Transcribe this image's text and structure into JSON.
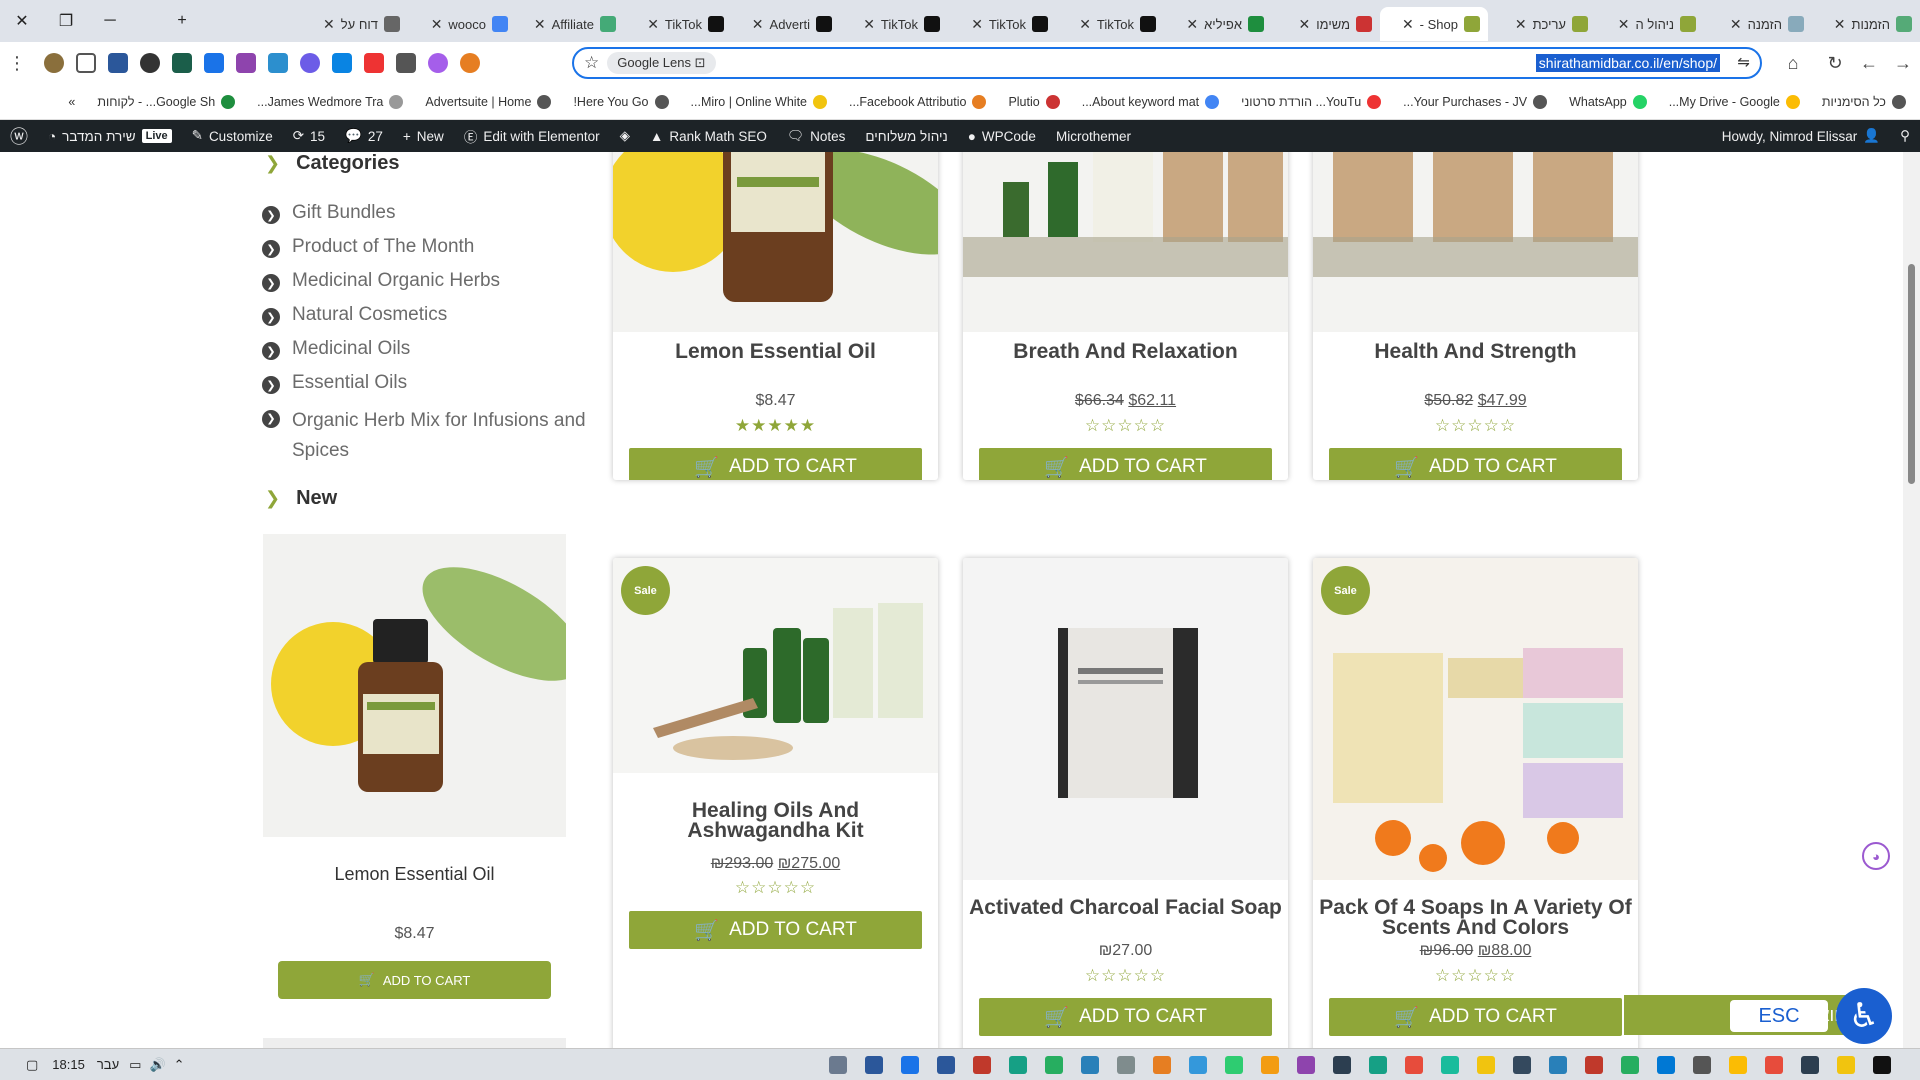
{
  "browser": {
    "tabs": [
      {
        "title": "הזמנות",
        "color": "#5a7"
      },
      {
        "title": "הזמנה",
        "color": "#8ab"
      },
      {
        "title": "ניהול ה",
        "color": "#8fa639"
      },
      {
        "title": "עריכת",
        "color": "#8fa639"
      },
      {
        "title": "Shop -",
        "color": "#8fa639",
        "active": true
      },
      {
        "title": "משימו",
        "color": "#c33"
      },
      {
        "title": "אפיליא",
        "color": "#1e8e3e"
      },
      {
        "title": "TikTok",
        "color": "#111"
      },
      {
        "title": "TikTok",
        "color": "#111"
      },
      {
        "title": "TikTok",
        "color": "#111"
      },
      {
        "title": "Adverti",
        "color": "#111"
      },
      {
        "title": "TikTok",
        "color": "#111"
      },
      {
        "title": "Affiliate",
        "color": "#4a7"
      },
      {
        "title": "wooco",
        "color": "#4285f4"
      },
      {
        "title": "דוח על",
        "color": "#666"
      }
    ],
    "omnibox": {
      "lens_label": "Google Lens",
      "url": "shirathamidbar.co.il/en/shop/"
    },
    "bookmarks": [
      {
        "label": "כל הסימניות",
        "color": "#555"
      },
      {
        "label": "My Drive - Google...",
        "color": "#fbbc04"
      },
      {
        "label": "WhatsApp",
        "color": "#25d366"
      },
      {
        "label": "Your Purchases - JV...",
        "color": "#555"
      },
      {
        "label": "YouTu... הורדת סרטוני",
        "color": "#e33"
      },
      {
        "label": "About keyword mat...",
        "color": "#4285f4"
      },
      {
        "label": "Plutio",
        "color": "#c33"
      },
      {
        "label": "Facebook Attributio...",
        "color": "#e67e22"
      },
      {
        "label": "Miro | Online White...",
        "color": "#f1c40f"
      },
      {
        "label": "Here You Go!",
        "color": "#555"
      },
      {
        "label": "Advertsuite | Home",
        "color": "#555"
      },
      {
        "label": "James Wedmore Tra...",
        "color": "#999"
      },
      {
        "label": "Google Sh... - לקוחות",
        "color": "#1e8e3e"
      }
    ]
  },
  "wp_admin_bar": {
    "site_name": "שירת המדבר",
    "live_badge": "Live",
    "customize": "Customize",
    "updates_count": "15",
    "comments_count": "27",
    "new": "New",
    "elementor": "Edit with Elementor",
    "rank_math": "Rank Math SEO",
    "notes": "Notes",
    "shipping": "ניהול משלוחים",
    "wpcode": "WPCode",
    "microthemer": "Microthemer",
    "howdy": "Howdy, Nimrod Elissar"
  },
  "sidebar": {
    "categories_heading": "Categories",
    "categories": [
      "Gift Bundles",
      "Product of The Month",
      "Medicinal Organic Herbs",
      "Natural Cosmetics",
      "Medicinal Oils",
      "Essential Oils",
      "Organic Herb Mix for Infusions and Spices"
    ],
    "new_heading": "New",
    "featured": {
      "title": "Lemon Essential Oil",
      "price": "$8.47",
      "button": "ADD TO CART"
    }
  },
  "products": [
    {
      "title": "Lemon Essential Oil",
      "old_price": "",
      "price": "$8.47",
      "rating": "★★★★★",
      "button": "ADD TO CART",
      "sale": ""
    },
    {
      "title": "Breath And Relaxation",
      "old_price": "$66.34",
      "price": "$62.11",
      "rating": "☆☆☆☆☆",
      "button": "ADD TO CART",
      "sale": ""
    },
    {
      "title": "Health And Strength",
      "old_price": "$50.82",
      "price": "$47.99",
      "rating": "☆☆☆☆☆",
      "button": "ADD TO CART",
      "sale": ""
    },
    {
      "title": "Healing Oils And Ashwagandha Kit",
      "old_price": "₪293.00",
      "price": "₪275.00",
      "rating": "☆☆☆☆☆",
      "button": "ADD TO CART",
      "sale": "Sale"
    },
    {
      "title": "Activated Charcoal Facial Soap",
      "old_price": "",
      "price": "₪27.00",
      "rating": "☆☆☆☆☆",
      "button": "ADD TO CART",
      "sale": ""
    },
    {
      "title": "Pack Of 4 Soaps In A Variety Of Scents And Colors",
      "old_price": "₪96.00",
      "price": "₪88.00",
      "rating": "☆☆☆☆☆",
      "button": "ADD TO CART",
      "sale": "Sale"
    }
  ],
  "floating": {
    "whatsapp": "וואטסאפ",
    "esc": "ESC"
  },
  "taskbar": {
    "time": "18:15",
    "lang": "עבר"
  },
  "colors": {
    "accent": "#8fa639",
    "wp_bar": "#1d2327",
    "link": "#1a5fd0"
  }
}
